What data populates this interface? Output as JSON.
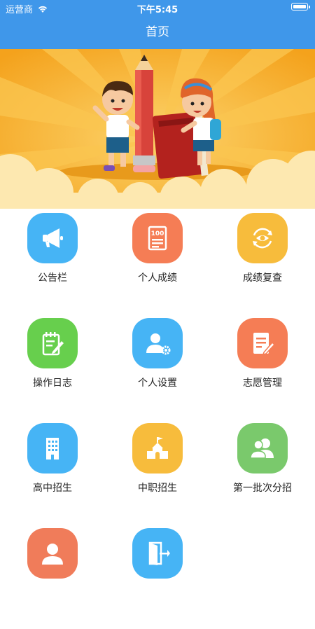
{
  "status_bar": {
    "carrier": "运营商",
    "time": "下午5:45"
  },
  "nav": {
    "title": "首页"
  },
  "banner": {
    "scene": "cartoon-kids-pencil-book"
  },
  "colors": {
    "header": "#3f97ea",
    "blue": "#46b4f5",
    "orange": "#f57d55",
    "yellow": "#f7bc3c",
    "green": "#67cf4d",
    "red": "#f07c5a",
    "grass": "#7ac96c"
  },
  "menu": [
    {
      "label": "公告栏",
      "icon": "megaphone-icon",
      "color": "#46b4f5"
    },
    {
      "label": "个人成绩",
      "icon": "score-sheet-icon",
      "color": "#f57d55"
    },
    {
      "label": "成绩复查",
      "icon": "eye-review-icon",
      "color": "#f7bc3c"
    },
    {
      "label": "操作日志",
      "icon": "log-notebook-icon",
      "color": "#67cf4d"
    },
    {
      "label": "个人设置",
      "icon": "user-settings-icon",
      "color": "#46b4f5"
    },
    {
      "label": "志愿管理",
      "icon": "edit-document-icon",
      "color": "#f57d55"
    },
    {
      "label": "高中招生",
      "icon": "building-icon",
      "color": "#46b4f5"
    },
    {
      "label": "中职招生",
      "icon": "school-icon",
      "color": "#f7bc3c"
    },
    {
      "label": "第一批次分招",
      "icon": "users-icon",
      "color": "#7ac96c"
    },
    {
      "label": "",
      "icon": "user-circle-icon",
      "color": "#f07c5a"
    },
    {
      "label": "",
      "icon": "exit-door-icon",
      "color": "#46b4f5"
    }
  ]
}
